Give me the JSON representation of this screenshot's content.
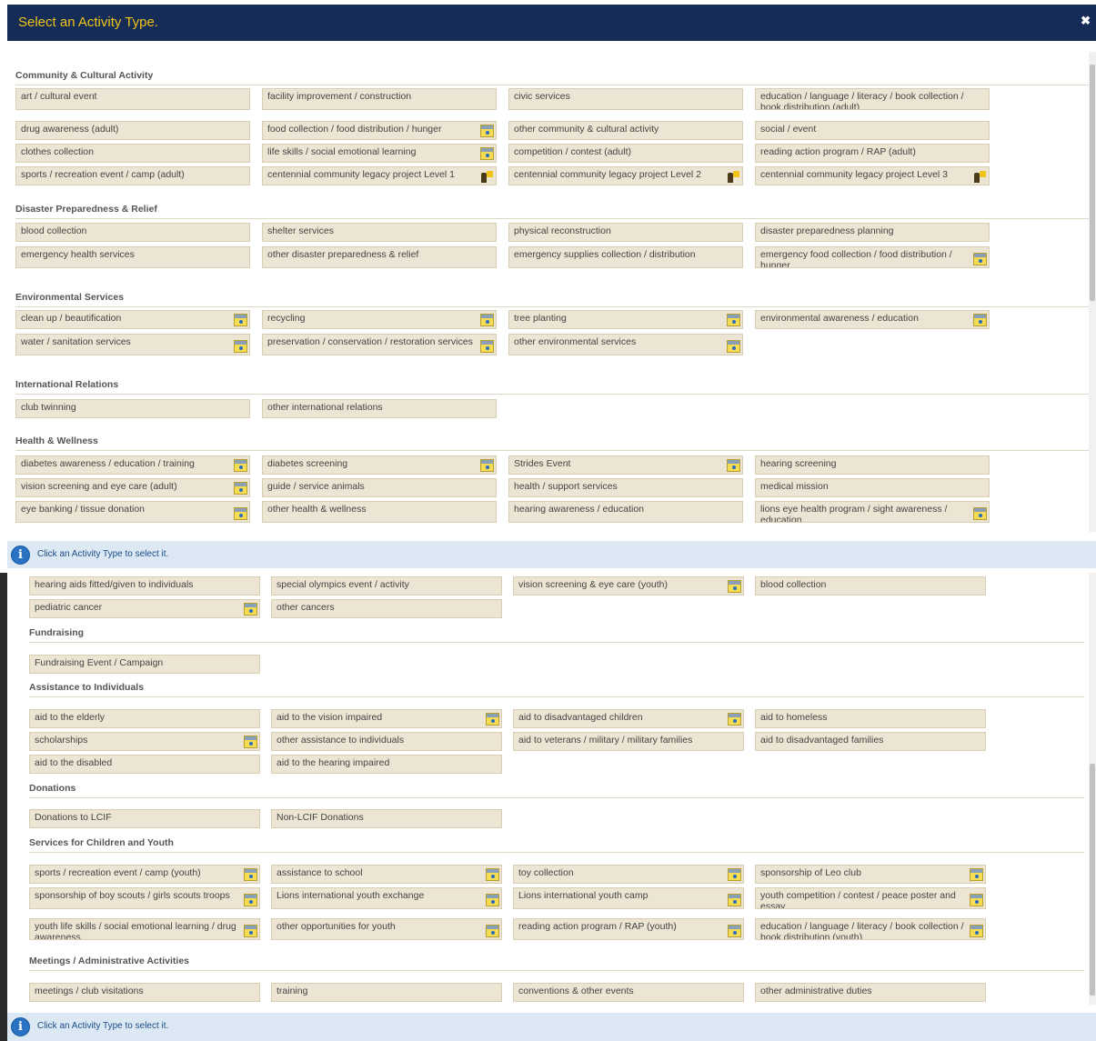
{
  "dialog": {
    "title": "Select an Activity Type.",
    "close_glyph": "✖",
    "info_text": "Click an Activity Type to select it.",
    "info_glyph": "i"
  },
  "top_sections": [
    {
      "title": "Community & Cultural Activity",
      "rows": [
        [
          {
            "label": "art / cultural event"
          },
          {
            "label": "facility improvement / construction"
          },
          {
            "label": "civic services"
          },
          {
            "label": "education / language / literacy / book collection / book distribution (adult)"
          }
        ],
        [
          {
            "label": "drug awareness (adult)"
          },
          {
            "label": "food collection / food distribution / hunger",
            "icon": "calendar-icon"
          },
          {
            "label": "other community & cultural activity"
          },
          {
            "label": "social / event"
          }
        ],
        [
          {
            "label": "clothes collection"
          },
          {
            "label": "life skills / social emotional learning",
            "icon": "calendar-icon"
          },
          {
            "label": "competition / contest (adult)"
          },
          {
            "label": "reading action program / RAP (adult)"
          }
        ],
        [
          {
            "label": "sports / recreation event / camp (adult)"
          },
          {
            "label": "centennial community legacy project Level 1",
            "icon": "legacy-icon"
          },
          {
            "label": "centennial community legacy project Level 2",
            "icon": "legacy-icon"
          },
          {
            "label": "centennial community legacy project Level 3",
            "icon": "legacy-icon"
          }
        ]
      ]
    },
    {
      "title": "Disaster Preparedness & Relief",
      "rows": [
        [
          {
            "label": "blood collection"
          },
          {
            "label": "shelter services"
          },
          {
            "label": "physical reconstruction"
          },
          {
            "label": "disaster preparedness planning"
          }
        ],
        [
          {
            "label": "emergency health services"
          },
          {
            "label": "other disaster preparedness & relief"
          },
          {
            "label": "emergency supplies collection / distribution"
          },
          {
            "label": "emergency food collection / food distribution / hunger",
            "icon": "calendar-icon"
          }
        ]
      ]
    },
    {
      "title": "Environmental Services",
      "rows": [
        [
          {
            "label": "clean up / beautification",
            "icon": "calendar-icon"
          },
          {
            "label": "recycling",
            "icon": "calendar-icon"
          },
          {
            "label": "tree planting",
            "icon": "calendar-icon"
          },
          {
            "label": "environmental awareness / education",
            "icon": "calendar-icon"
          }
        ],
        [
          {
            "label": "water / sanitation services",
            "icon": "calendar-icon"
          },
          {
            "label": "preservation / conservation / restoration services",
            "icon": "calendar-icon"
          },
          {
            "label": "other environmental services",
            "icon": "calendar-icon"
          }
        ]
      ]
    },
    {
      "title": "International Relations",
      "rows": [
        [
          {
            "label": "club twinning"
          },
          {
            "label": "other international relations"
          }
        ]
      ]
    },
    {
      "title": "Health & Wellness",
      "rows": [
        [
          {
            "label": "diabetes awareness / education / training",
            "icon": "calendar-icon"
          },
          {
            "label": "diabetes screening",
            "icon": "calendar-icon"
          },
          {
            "label": "Strides Event",
            "icon": "calendar-icon"
          },
          {
            "label": "hearing screening"
          }
        ],
        [
          {
            "label": "vision screening and eye care (adult)",
            "icon": "calendar-icon"
          },
          {
            "label": "guide / service animals"
          },
          {
            "label": "health / support services"
          },
          {
            "label": "medical mission"
          }
        ],
        [
          {
            "label": "eye banking / tissue donation",
            "icon": "calendar-icon"
          },
          {
            "label": "other health & wellness"
          },
          {
            "label": "hearing awareness / education"
          },
          {
            "label": "lions eye health program / sight awareness / education",
            "icon": "calendar-icon"
          }
        ]
      ]
    }
  ],
  "bottom_leading_rows": [
    [
      {
        "label": "hearing aids fitted/given to individuals"
      },
      {
        "label": "special olympics event / activity"
      },
      {
        "label": "vision screening & eye care (youth)",
        "icon": "calendar-icon"
      },
      {
        "label": "blood collection"
      }
    ],
    [
      {
        "label": "pediatric cancer",
        "icon": "calendar-icon"
      },
      {
        "label": "other cancers"
      }
    ]
  ],
  "bottom_sections": [
    {
      "title": "Fundraising",
      "rows": [
        [
          {
            "label": "Fundraising Event / Campaign"
          }
        ]
      ]
    },
    {
      "title": "Assistance to Individuals",
      "rows": [
        [
          {
            "label": "aid to the elderly"
          },
          {
            "label": "aid to the vision impaired",
            "icon": "calendar-icon"
          },
          {
            "label": "aid to disadvantaged children",
            "icon": "calendar-icon"
          },
          {
            "label": "aid to homeless"
          }
        ],
        [
          {
            "label": "scholarships",
            "icon": "calendar-icon"
          },
          {
            "label": "other assistance to individuals"
          },
          {
            "label": "aid to veterans / military / military families"
          },
          {
            "label": "aid to disadvantaged families"
          }
        ],
        [
          {
            "label": "aid to the disabled"
          },
          {
            "label": "aid to the hearing impaired"
          }
        ]
      ]
    },
    {
      "title": "Donations",
      "rows": [
        [
          {
            "label": "Donations to LCIF"
          },
          {
            "label": "Non-LCIF Donations"
          }
        ]
      ]
    },
    {
      "title": "Services for Children and Youth",
      "rows": [
        [
          {
            "label": "sports / recreation event / camp (youth)",
            "icon": "calendar-icon"
          },
          {
            "label": "assistance to school",
            "icon": "calendar-icon"
          },
          {
            "label": "toy collection",
            "icon": "calendar-icon"
          },
          {
            "label": "sponsorship of Leo club",
            "icon": "calendar-icon"
          }
        ],
        [
          {
            "label": "sponsorship of boy scouts / girls scouts troops",
            "icon": "calendar-icon"
          },
          {
            "label": "Lions international youth exchange",
            "icon": "calendar-icon"
          },
          {
            "label": "Lions international youth camp",
            "icon": "calendar-icon"
          },
          {
            "label": "youth competition / contest / peace poster and essay",
            "icon": "calendar-icon"
          }
        ],
        [
          {
            "label": "youth life skills / social emotional learning / drug awareness",
            "icon": "calendar-icon"
          },
          {
            "label": "other opportunities for youth",
            "icon": "calendar-icon"
          },
          {
            "label": "reading action program / RAP (youth)",
            "icon": "calendar-icon"
          },
          {
            "label": "education / language / literacy / book collection / book distribution (youth)",
            "icon": "calendar-icon"
          }
        ]
      ]
    },
    {
      "title": "Meetings / Administrative Activities",
      "rows": [
        [
          {
            "label": "meetings / club visitations"
          },
          {
            "label": "training"
          },
          {
            "label": "conventions & other events"
          },
          {
            "label": "other administrative duties"
          }
        ]
      ]
    }
  ]
}
